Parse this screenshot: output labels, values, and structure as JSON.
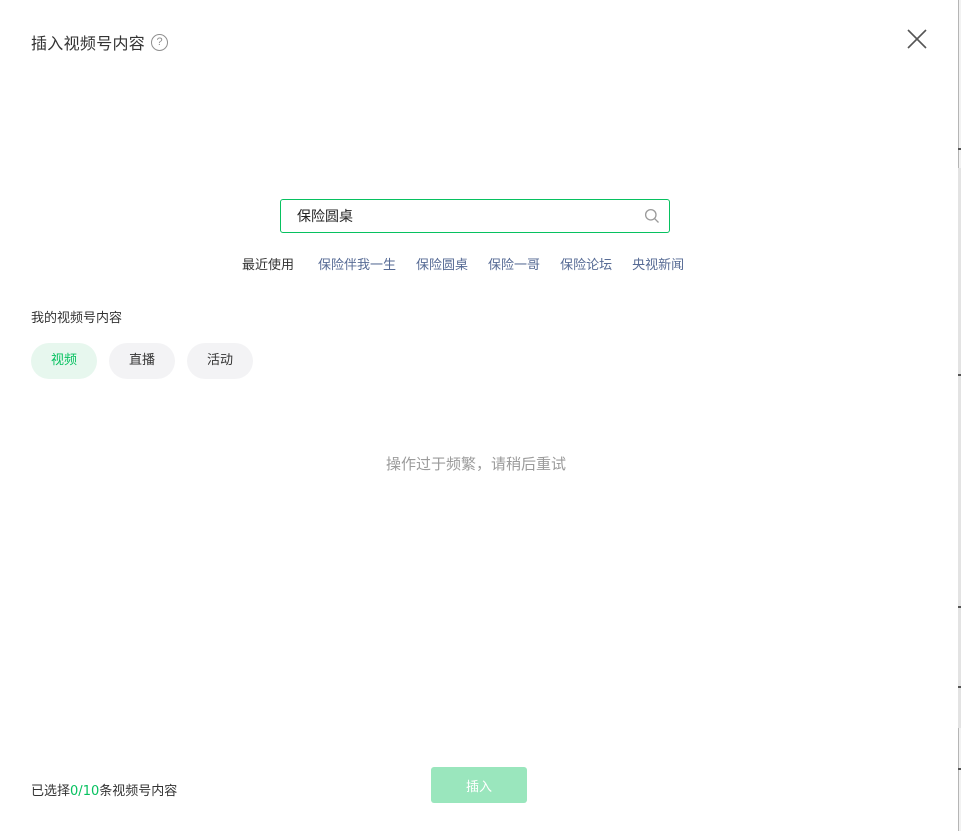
{
  "header": {
    "title": "插入视频号内容",
    "help_icon": "?"
  },
  "search": {
    "value": "保险圆桌",
    "icon": "search-icon"
  },
  "recent": {
    "label": "最近使用",
    "items": [
      "保险伴我一生",
      "保险圆桌",
      "保险一哥",
      "保险论坛",
      "央视新闻"
    ]
  },
  "section": {
    "title": "我的视频号内容"
  },
  "tabs": [
    {
      "label": "视频",
      "active": true
    },
    {
      "label": "直播",
      "active": false
    },
    {
      "label": "活动",
      "active": false
    }
  ],
  "empty_message": "操作过于频繁，请稍后重试",
  "footer": {
    "prefix": "已选择",
    "selected": "0",
    "separator": "/",
    "max": "10",
    "suffix": "条视频号内容",
    "insert_label": "插入"
  },
  "colors": {
    "accent": "#07c160",
    "link": "#576b95",
    "button_disabled": "#9ae6bd",
    "tab_active_bg": "#e7f7ee",
    "tab_bg": "#f3f3f5"
  }
}
